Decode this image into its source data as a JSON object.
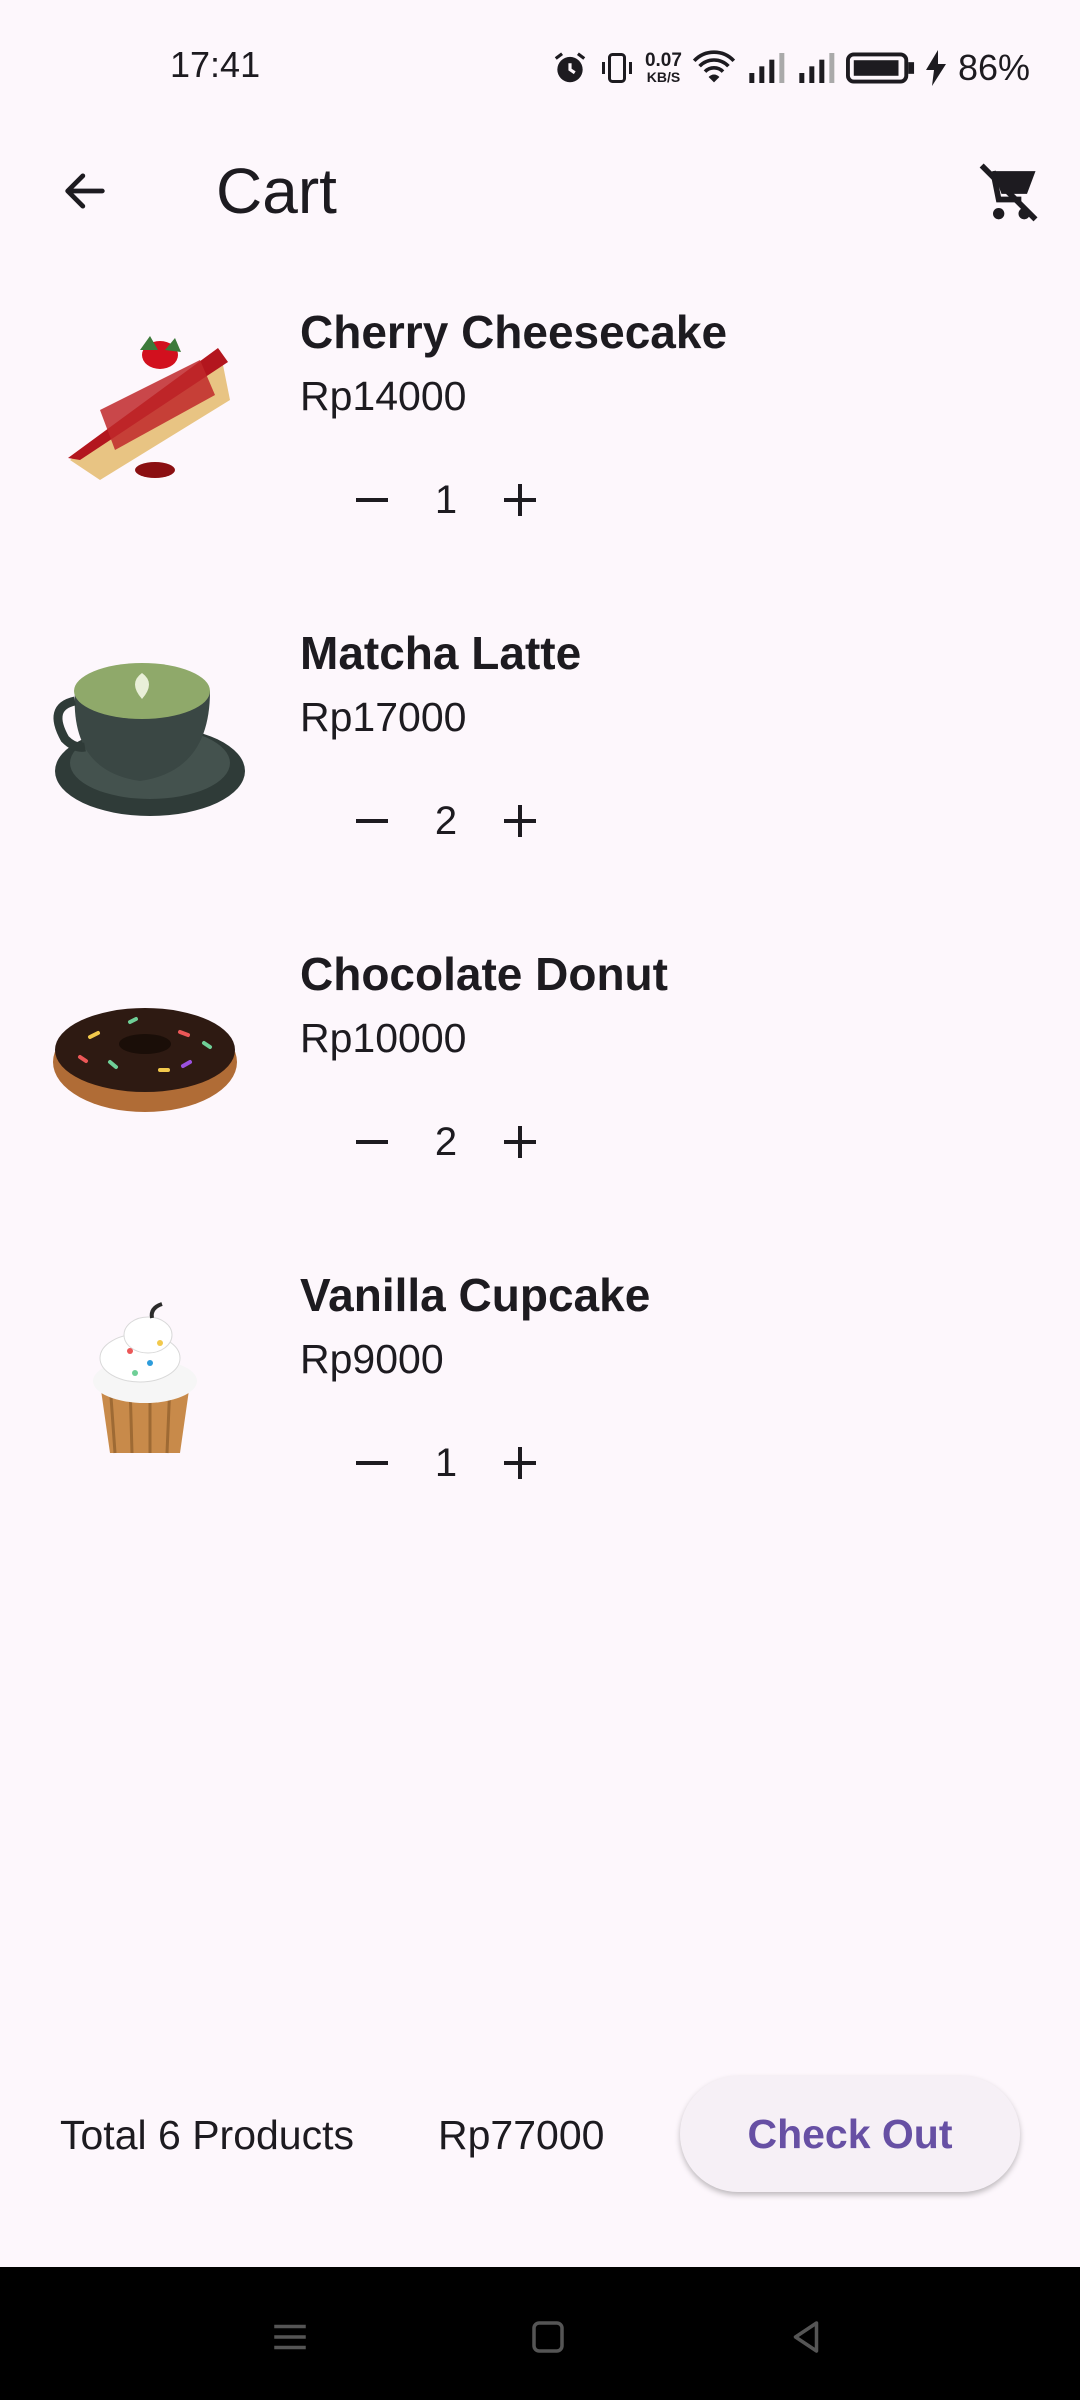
{
  "status_bar": {
    "time": "17:41",
    "net_speed_value": "0.07",
    "net_speed_unit": "KB/S",
    "battery_percent": "86%"
  },
  "app_bar": {
    "title": "Cart",
    "back_icon": "arrow-back-icon",
    "clear_icon": "remove-shopping-cart-icon"
  },
  "cart": {
    "items": [
      {
        "name": "Cherry Cheesecake",
        "price": "Rp14000",
        "quantity": "1",
        "image": "cheesecake-image"
      },
      {
        "name": "Matcha Latte",
        "price": "Rp17000",
        "quantity": "2",
        "image": "matcha-latte-image"
      },
      {
        "name": "Chocolate Donut",
        "price": "Rp10000",
        "quantity": "2",
        "image": "chocolate-donut-image"
      },
      {
        "name": "Vanilla Cupcake",
        "price": "Rp9000",
        "quantity": "1",
        "image": "vanilla-cupcake-image"
      }
    ]
  },
  "footer": {
    "total_label": "Total 6 Products",
    "total_value": "Rp77000",
    "checkout_label": "Check Out"
  },
  "colors": {
    "background": "#fdf7fc",
    "accent": "#6750a4",
    "text": "#1d1b20"
  }
}
